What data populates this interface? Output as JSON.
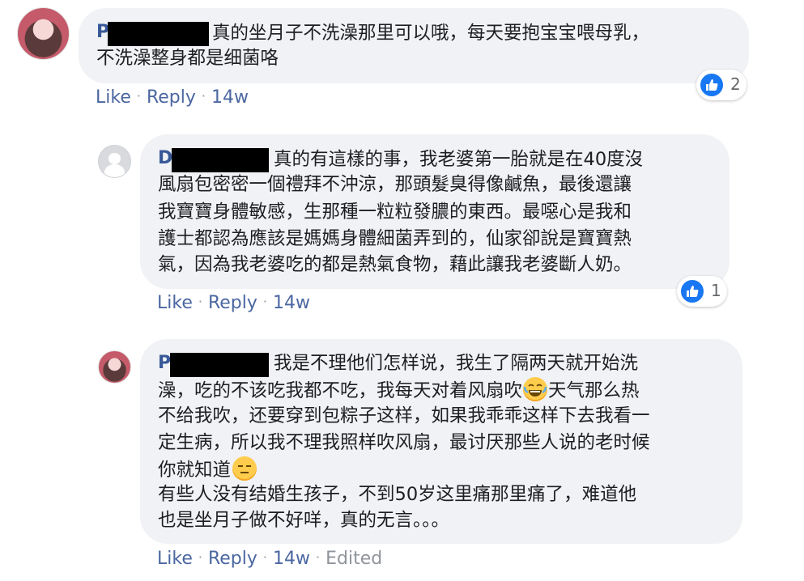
{
  "comments": [
    {
      "author": "P",
      "lines": [
        "真的坐月子不洗澡那里可以哦，每天要抱宝宝喂母乳，",
        "不洗澡整身都是细菌咯"
      ],
      "actions": {
        "like": "Like",
        "reply": "Reply",
        "time": "14w",
        "edited": ""
      },
      "reactions": {
        "count": "2",
        "icon": "like-icon"
      }
    },
    {
      "author": "D",
      "lines": [
        "真的有這樣的事，我老婆第一胎就是在40度沒",
        "風扇包密密一個禮拜不沖涼，那頭髮臭得像鹹魚，最後還讓",
        "我寶寶身體敏感，生那種一粒粒發膿的東西。最噁心是我和",
        "護士都認為應該是媽媽身體細菌弄到的，仙家卻說是寶寶熱",
        "氣，因為我老婆吃的都是熱氣食物，藉此讓我老婆斷人奶。"
      ],
      "actions": {
        "like": "Like",
        "reply": "Reply",
        "time": "14w",
        "edited": ""
      },
      "reactions": {
        "count": "1",
        "icon": "like-icon"
      }
    },
    {
      "author": "P",
      "lines": [
        "我是不理他们怎样说，我生了隔两天就开始洗",
        "澡，吃的不该吃我都不吃，我每天对着风扇吹",
        "天气那么热",
        "不给我吹，还要穿到包粽子这样，如果我乖乖这样下去我看一",
        "定生病，所以我不理我照样吹风扇，最讨厌那些人说的老时候",
        "你就知道",
        "有些人没有结婚生孩子，不到50岁这里痛那里痛了，难道他",
        "也是坐月子做不好咩，真的无言。。。"
      ],
      "emojis": [
        "joy-emoji",
        "expressionless-emoji"
      ],
      "actions": {
        "like": "Like",
        "reply": "Reply",
        "time": "14w",
        "edited": "Edited"
      }
    }
  ],
  "separator": "·"
}
